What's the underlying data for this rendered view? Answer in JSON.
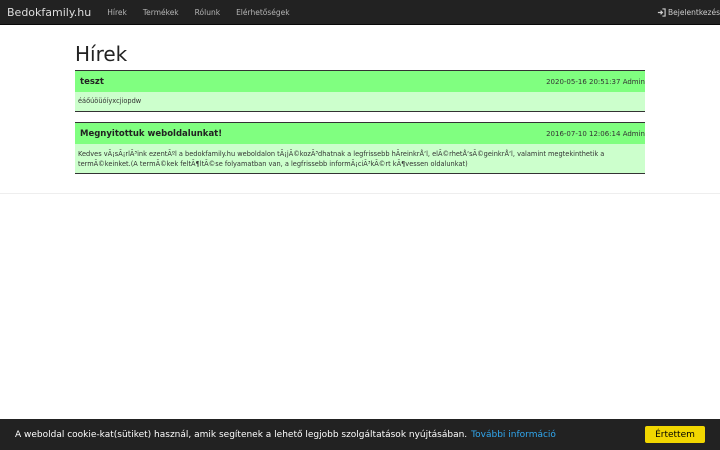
{
  "navbar": {
    "brand": "Bedokfamily.hu",
    "links": [
      "Hírek",
      "Termékek",
      "Rólunk",
      "Elérhetőségek"
    ],
    "login_label": "Bejelentkezés"
  },
  "page": {
    "title": "Hírek"
  },
  "news": [
    {
      "title": "teszt",
      "datetime": "2020-05-16 20:51:37",
      "author": "Admin",
      "body": "éáőúöüóíyxcjiopdw"
    },
    {
      "title": "Megnyitottuk weboldalunkat!",
      "datetime": "2016-07-10 12:06:14",
      "author": "Admin",
      "body": "Kedves vÃ¡sÃ¡rlÃ³ink ezentÃºl a bedokfamily.hu weboldalon tÃ¡jÃ©kozÃ³dhatnak a legfrissebb hÃreinkrÅ‘l, elÃ©rhetÅ‘sÃ©geinkrÅ‘l, valamint megtekinthetik a termÃ©keinket.(A termÃ©kek feltÃ¶ltÃ©se folyamatban van, a legfrissebb informÃ¡ciÃ³kÃ©rt kÃ¶vessen oldalunkat)"
    }
  ],
  "cookie": {
    "text": "A weboldal cookie-kat(sütiket) használ, amik segítenek a lehető legjobb szolgáltatások nyújtásában.",
    "link_label": "További információ",
    "button_label": "Értettem"
  },
  "colors": {
    "navbar_bg": "#222222",
    "news_header": "#80ff80",
    "news_body": "#ccffcc",
    "cookie_button": "#f1d600",
    "cookie_link": "#31a8f0"
  }
}
